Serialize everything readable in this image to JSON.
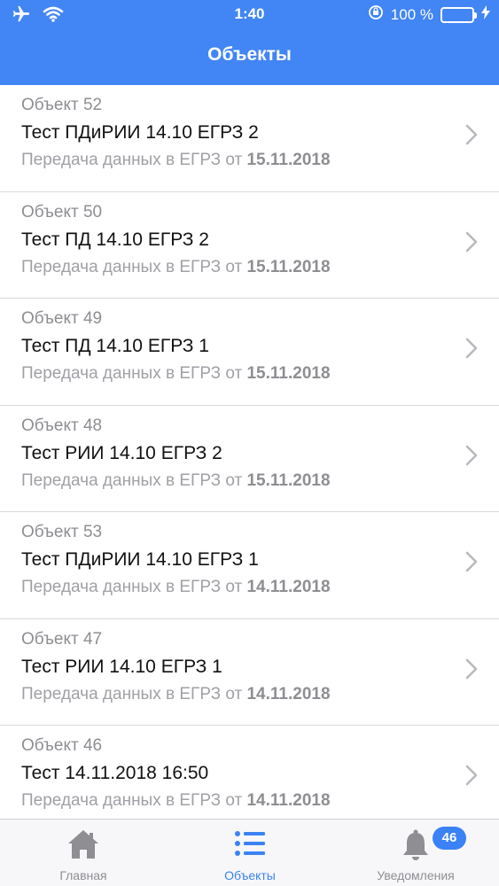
{
  "status_bar": {
    "time": "1:40",
    "battery_percent": "100 %",
    "icons": [
      "airplane-icon",
      "wifi-icon",
      "orientation-lock-icon",
      "battery-icon",
      "charging-icon"
    ]
  },
  "nav": {
    "title": "Объекты"
  },
  "objects": [
    {
      "object_label": "Объект 52",
      "name": "Тест ПДиРИИ 14.10 ЕГРЗ 2",
      "transfer_text": "Передача данных в ЕГРЗ от",
      "date": "15.11.2018"
    },
    {
      "object_label": "Объект 50",
      "name": "Тест ПД 14.10 ЕГРЗ 2",
      "transfer_text": "Передача данных в ЕГРЗ от",
      "date": "15.11.2018"
    },
    {
      "object_label": "Объект 49",
      "name": "Тест ПД 14.10 ЕГРЗ 1",
      "transfer_text": "Передача данных в ЕГРЗ от",
      "date": "15.11.2018"
    },
    {
      "object_label": "Объект 48",
      "name": "Тест РИИ 14.10 ЕГРЗ 2",
      "transfer_text": "Передача данных в ЕГРЗ от",
      "date": "15.11.2018"
    },
    {
      "object_label": "Объект 53",
      "name": "Тест ПДиРИИ 14.10 ЕГРЗ 1",
      "transfer_text": "Передача данных в ЕГРЗ от",
      "date": "14.11.2018"
    },
    {
      "object_label": "Объект 47",
      "name": "Тест РИИ 14.10 ЕГРЗ 1",
      "transfer_text": "Передача данных в ЕГРЗ от",
      "date": "14.11.2018"
    },
    {
      "object_label": "Объект 46",
      "name": "Тест 14.11.2018 16:50",
      "transfer_text": "Передача данных в ЕГРЗ от",
      "date": "14.11.2018"
    }
  ],
  "tabbar": {
    "home_label": "Главная",
    "objects_label": "Объекты",
    "notifications_label": "Уведомления",
    "notifications_badge": "46",
    "active_tab": "objects"
  },
  "colors": {
    "header_bg": "#4285f4",
    "accent": "#3b82f6",
    "battery_fill": "#6fe06f"
  }
}
